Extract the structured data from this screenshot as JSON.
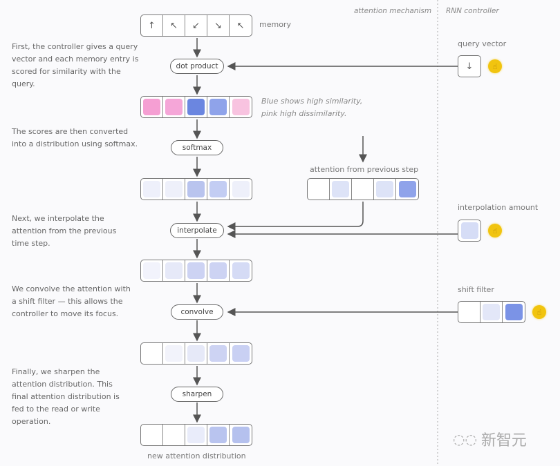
{
  "headers": {
    "attention": "attention mechanism",
    "controller": "RNN controller"
  },
  "memory": {
    "label": "memory",
    "cells": [
      "↑",
      "↖",
      "↙",
      "↘",
      "↖"
    ]
  },
  "ops": {
    "dot_product": "dot product",
    "softmax": "softmax",
    "interpolate": "interpolate",
    "convolve": "convolve",
    "sharpen": "sharpen"
  },
  "descriptions": {
    "dot_product": [
      "First, the controller gives a query",
      "vector and each memory entry is",
      "scored for similarity with the",
      "query."
    ],
    "softmax": [
      "The scores are then converted",
      "into a distribution using softmax."
    ],
    "interpolate": [
      "Next, we interpolate the",
      "attention from the previous",
      "time step."
    ],
    "convolve": [
      "We convolve the attention with",
      "a shift filter — this allows the",
      "controller to move its focus."
    ],
    "sharpen": [
      "Finally, we sharpen the",
      "attention distribution. This",
      "final attention distribution is",
      "fed to the read or write",
      "operation."
    ]
  },
  "similarity_note": [
    "Blue shows high similarity,",
    "pink high dissimilarity."
  ],
  "rows": {
    "scores": [
      "#f59fd3",
      "#f5a6d8",
      "#6b86e0",
      "#8fa3ea",
      "#f8c3e0"
    ],
    "softmax": [
      "#eef0fb",
      "#eef0fa",
      "#b9c4ee",
      "#c3cdf3",
      "#eef0fa"
    ],
    "previous": [
      "#ffffff",
      "#dde3f7",
      "#ffffff",
      "#dde3f7",
      "#8fa3ea"
    ],
    "interpolated": [
      "#f2f3fc",
      "#e6e9f8",
      "#cdd3f3",
      "#cdd3f3",
      "#d5dbf5"
    ],
    "convolved": [
      "#ffffff",
      "#f2f3fb",
      "#e6e9f8",
      "#cdd3f3",
      "#c9d0f3"
    ],
    "sharpened": [
      "#ffffff",
      "#ffffff",
      "#e9ecfa",
      "#b9c4ef",
      "#b5c1ee"
    ]
  },
  "previous_label": "attention from previous step",
  "output_label": "new attention distribution",
  "controller": {
    "query_vector": {
      "label": "query vector",
      "glyph": "↓"
    },
    "interpolation_amount": {
      "label": "interpolation amount",
      "color": "#d6ddf6"
    },
    "shift_filter": {
      "label": "shift filter",
      "colors": [
        "#ffffff",
        "#e3e7f8",
        "#7b93e6"
      ]
    },
    "hand_glyph": "☝"
  },
  "watermark": "新智元"
}
